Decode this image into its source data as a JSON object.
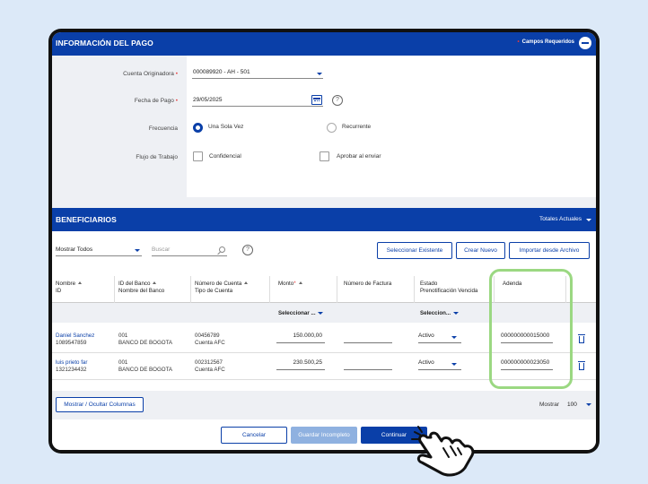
{
  "payment_info": {
    "title": "INFORMACIÓN DEL PAGO",
    "required_label": "Campos Requeridos",
    "account_label": "Cuenta Originadora",
    "account_value": "000089920 - AH - 501",
    "date_label": "Fecha de Pago",
    "date_value": "29/05/2025",
    "frequency_label": "Frecuencia",
    "freq_once": "Una Sola Vez",
    "freq_recurrent": "Recurrente",
    "workflow_label": "Flujo de Trabajo",
    "wf_confidential": "Confidencial",
    "wf_approve": "Aprobar al enviar"
  },
  "beneficiaries": {
    "title": "BENEFICIARIOS",
    "totals": "Totales Actuales",
    "show_select": "Mostrar Todos",
    "search_placeholder": "Buscar",
    "btn_select_existing": "Seleccionar Existente",
    "btn_create_new": "Crear Nuevo",
    "btn_import": "Importar desde Archivo",
    "columns": {
      "name": "Nombre",
      "id": "ID",
      "bank_id": "ID del Banco",
      "bank_name": "Nombre del Banco",
      "account_number": "Número de Cuenta",
      "account_type": "Tipo de Cuenta",
      "amount": "Monto",
      "invoice": "Número de Factura",
      "status": "Estado",
      "prenotif": "Prenotificación Vencida",
      "addenda": "Adenda"
    },
    "filter_amount": "Seleccionar ...",
    "filter_status": "Seleccion...",
    "rows": [
      {
        "name": "Daniel Sanchez",
        "id": "1089547859",
        "bank_id": "001",
        "bank_name": "BANCO DE BOGOTA",
        "account": "00456789",
        "account_type": "Cuenta AFC",
        "amount": "150.000,00",
        "status": "Activo",
        "addenda": "000000000015000"
      },
      {
        "name": "luis prieto far",
        "id": "1321234432",
        "bank_id": "001",
        "bank_name": "BANCO DE BOGOTA",
        "account": "002312567",
        "account_type": "Cuenta AFC",
        "amount": "230.500,25",
        "status": "Activo",
        "addenda": "000000000023050"
      }
    ],
    "btn_columns": "Mostrar / Ocultar Columnas",
    "show_label": "Mostrar",
    "show_count": "100"
  },
  "actions": {
    "cancel": "Cancelar",
    "save_incomplete": "Guardar Incompleto",
    "continue": "Continuar"
  },
  "colors": {
    "brand_blue": "#0a3fa8",
    "highlight_green": "#9bd882",
    "required_red": "#e83b3b"
  }
}
